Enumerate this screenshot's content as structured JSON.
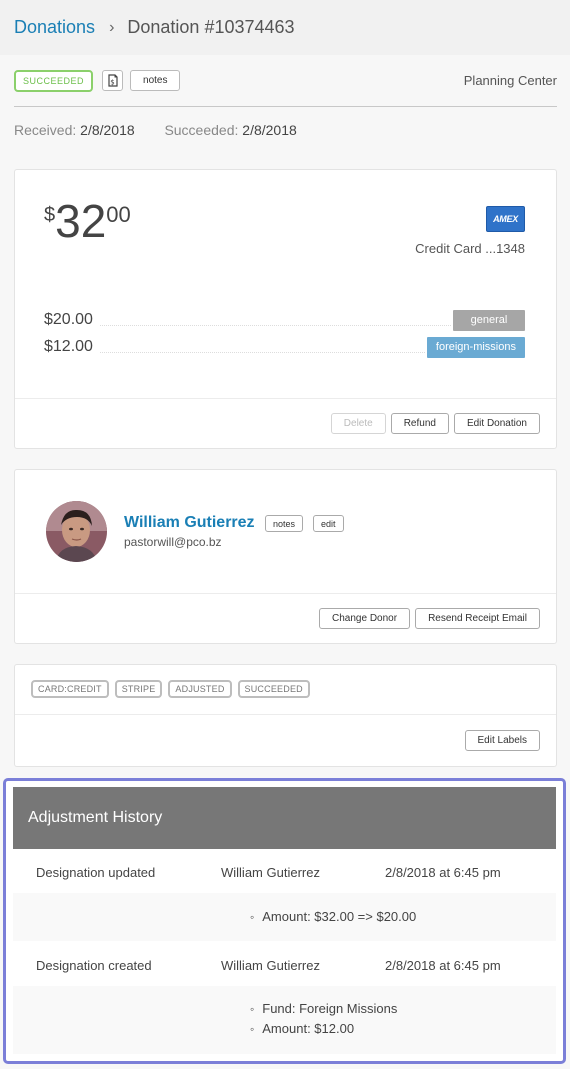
{
  "breadcrumb": {
    "parent": "Donations",
    "separator": "›",
    "current": "Donation #10374463"
  },
  "toolbar": {
    "status": "SUCCEEDED",
    "receipt_icon": "receipt-dollar-icon",
    "notes_label": "notes",
    "organization": "Planning Center"
  },
  "dates": {
    "received_label": "Received:",
    "received_value": "2/8/2018",
    "succeeded_label": "Succeeded:",
    "succeeded_value": "2/8/2018"
  },
  "amount_card": {
    "currency": "$",
    "whole": "32",
    "cents": "00",
    "card_brand": "AMEX",
    "card_description": "Credit Card ...1348",
    "designations": [
      {
        "amount": "$20.00",
        "fund": "general",
        "color": "#a6a6a6"
      },
      {
        "amount": "$12.00",
        "fund": "foreign-missions",
        "color": "#6aaad3"
      }
    ],
    "buttons": {
      "delete": "Delete",
      "refund": "Refund",
      "edit": "Edit Donation"
    }
  },
  "donor_card": {
    "name": "William Gutierrez",
    "email": "pastorwill@pco.bz",
    "notes_label": "notes",
    "edit_label": "edit",
    "buttons": {
      "change_donor": "Change Donor",
      "resend_receipt": "Resend Receipt Email"
    }
  },
  "labels_card": {
    "labels": [
      "CARD:CREDIT",
      "STRIPE",
      "ADJUSTED",
      "SUCCEEDED"
    ],
    "edit_labels": "Edit Labels"
  },
  "adjustment_history": {
    "title": "Adjustment History",
    "entries": [
      {
        "action": "Designation updated",
        "user": "William Gutierrez",
        "timestamp": "2/8/2018 at 6:45 pm",
        "details": [
          "Amount: $32.00 => $20.00"
        ]
      },
      {
        "action": "Designation created",
        "user": "William Gutierrez",
        "timestamp": "2/8/2018 at 6:45 pm",
        "details": [
          "Fund: Foreign Missions",
          "Amount: $12.00"
        ]
      }
    ]
  },
  "colors": {
    "link": "#1a7fb5",
    "success": "#8bd06b",
    "highlight_frame": "#7b7fd8",
    "history_header": "#777777"
  }
}
